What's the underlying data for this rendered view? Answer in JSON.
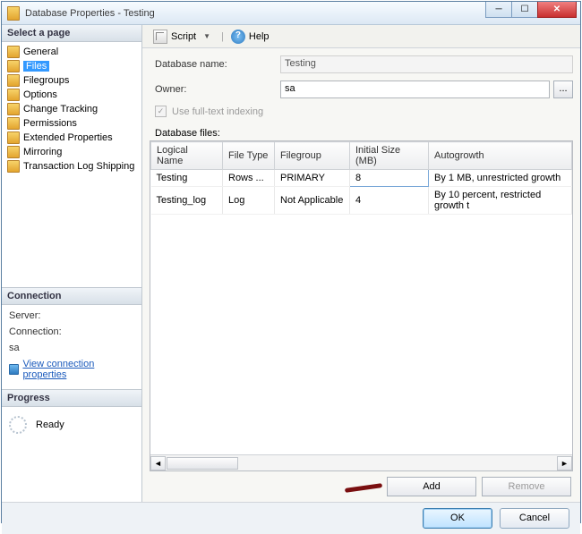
{
  "title": "Database Properties - Testing",
  "sidebar": {
    "header": "Select a page",
    "items": [
      {
        "label": "General"
      },
      {
        "label": "Files",
        "selected": true
      },
      {
        "label": "Filegroups"
      },
      {
        "label": "Options"
      },
      {
        "label": "Change Tracking"
      },
      {
        "label": "Permissions"
      },
      {
        "label": "Extended Properties"
      },
      {
        "label": "Mirroring"
      },
      {
        "label": "Transaction Log Shipping"
      }
    ]
  },
  "connection": {
    "header": "Connection",
    "server_label": "Server:",
    "server_value": "",
    "conn_label": "Connection:",
    "conn_value": "sa",
    "link": "View connection properties"
  },
  "progress": {
    "header": "Progress",
    "status": "Ready"
  },
  "toolbar": {
    "script": "Script",
    "help": "Help"
  },
  "form": {
    "dbname_label": "Database name:",
    "dbname_value": "Testing",
    "owner_label": "Owner:",
    "owner_value": "sa",
    "fulltext_label": "Use full-text indexing",
    "files_label": "Database files:"
  },
  "table": {
    "headers": [
      "Logical Name",
      "File Type",
      "Filegroup",
      "Initial Size (MB)",
      "Autogrowth"
    ],
    "rows": [
      {
        "name": "Testing",
        "ftype": "Rows ...",
        "fg": "PRIMARY",
        "isize": "8",
        "ag": "By 1 MB, unrestricted growth"
      },
      {
        "name": "Testing_log",
        "ftype": "Log",
        "fg": "Not Applicable",
        "isize": "4",
        "ag": "By 10 percent, restricted growth t"
      }
    ]
  },
  "buttons": {
    "add": "Add",
    "remove": "Remove",
    "ok": "OK",
    "cancel": "Cancel"
  }
}
